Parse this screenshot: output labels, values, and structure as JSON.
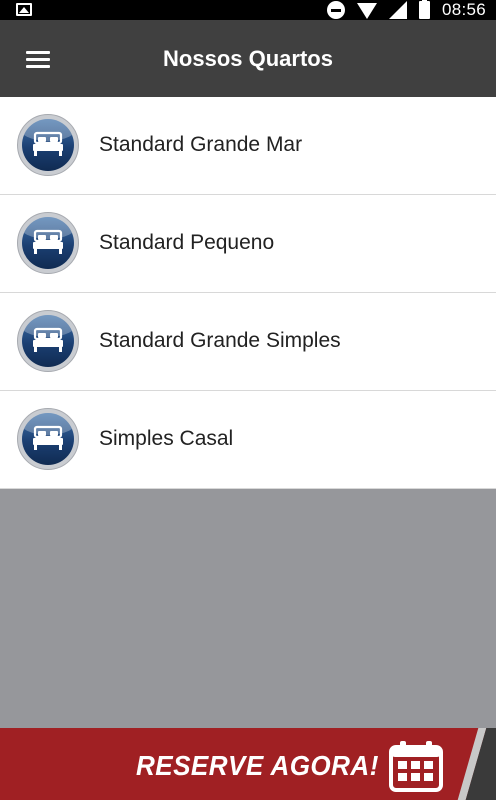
{
  "status_bar": {
    "time": "08:56",
    "icons": [
      "image-icon",
      "do-not-disturb-icon",
      "wifi-icon",
      "signal-icon",
      "battery-icon"
    ]
  },
  "app_bar": {
    "title": "Nossos Quartos",
    "menu_icon": "hamburger-menu-icon"
  },
  "rooms": [
    {
      "label": "Standard Grande Mar",
      "icon": "bed-icon"
    },
    {
      "label": "Standard Pequeno",
      "icon": "bed-icon"
    },
    {
      "label": "Standard Grande Simples",
      "icon": "bed-icon"
    },
    {
      "label": "Simples Casal",
      "icon": "bed-icon"
    }
  ],
  "reserve": {
    "label": "RESERVE AGORA!",
    "icon": "calendar-icon"
  },
  "colors": {
    "status_bar": "#000000",
    "app_bar": "#404040",
    "list_background": "#ffffff",
    "empty_area": "#96979b",
    "reserve_bar": "#a02023",
    "avatar_blue": "#1b3f72"
  }
}
